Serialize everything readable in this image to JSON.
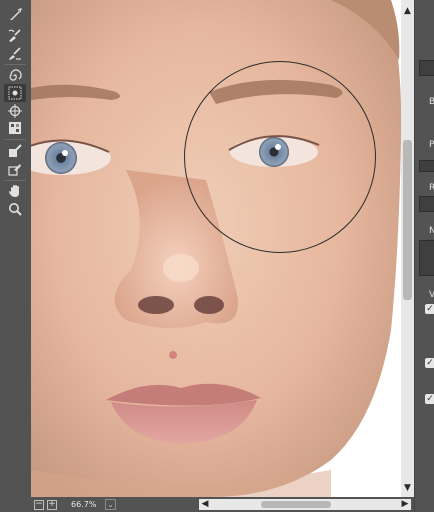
{
  "toolbar": {
    "tools": [
      {
        "name": "forward-warp-tool",
        "icon": "finger-warp-icon"
      },
      {
        "name": "reconstruct-tool",
        "icon": "reconstruct-brush-icon"
      },
      {
        "name": "smooth-tool",
        "icon": "smooth-brush-icon"
      },
      {
        "name": "twirl-clockwise-tool",
        "icon": "twirl-icon"
      },
      {
        "name": "pucker-tool",
        "icon": "pucker-icon",
        "active": true
      },
      {
        "name": "bloat-tool",
        "icon": "bloat-icon"
      },
      {
        "name": "push-left-tool",
        "icon": "push-left-icon"
      },
      {
        "name": "freeze-mask-tool",
        "icon": "freeze-mask-icon"
      },
      {
        "name": "thaw-mask-tool",
        "icon": "thaw-mask-icon"
      },
      {
        "name": "hand-tool",
        "icon": "hand-icon"
      },
      {
        "name": "zoom-tool",
        "icon": "zoom-icon"
      }
    ]
  },
  "statusbar": {
    "zoom_out": "−",
    "zoom_in": "+",
    "zoom_level": "66.7%",
    "zoom_dropdown": "⌄"
  },
  "scroll": {
    "up": "▲",
    "down": "▼",
    "left": "◀",
    "right": "▶"
  },
  "right_panel": {
    "letters": [
      "B",
      "Pr",
      "R",
      "N",
      "V"
    ],
    "check": "✓"
  },
  "colors": {
    "chrome": "#535353",
    "canvas_bg": "#ffffff",
    "scrollbar": "#e8e8e8",
    "skin": "#e8bfa6",
    "iris": "#7a8ea3"
  }
}
